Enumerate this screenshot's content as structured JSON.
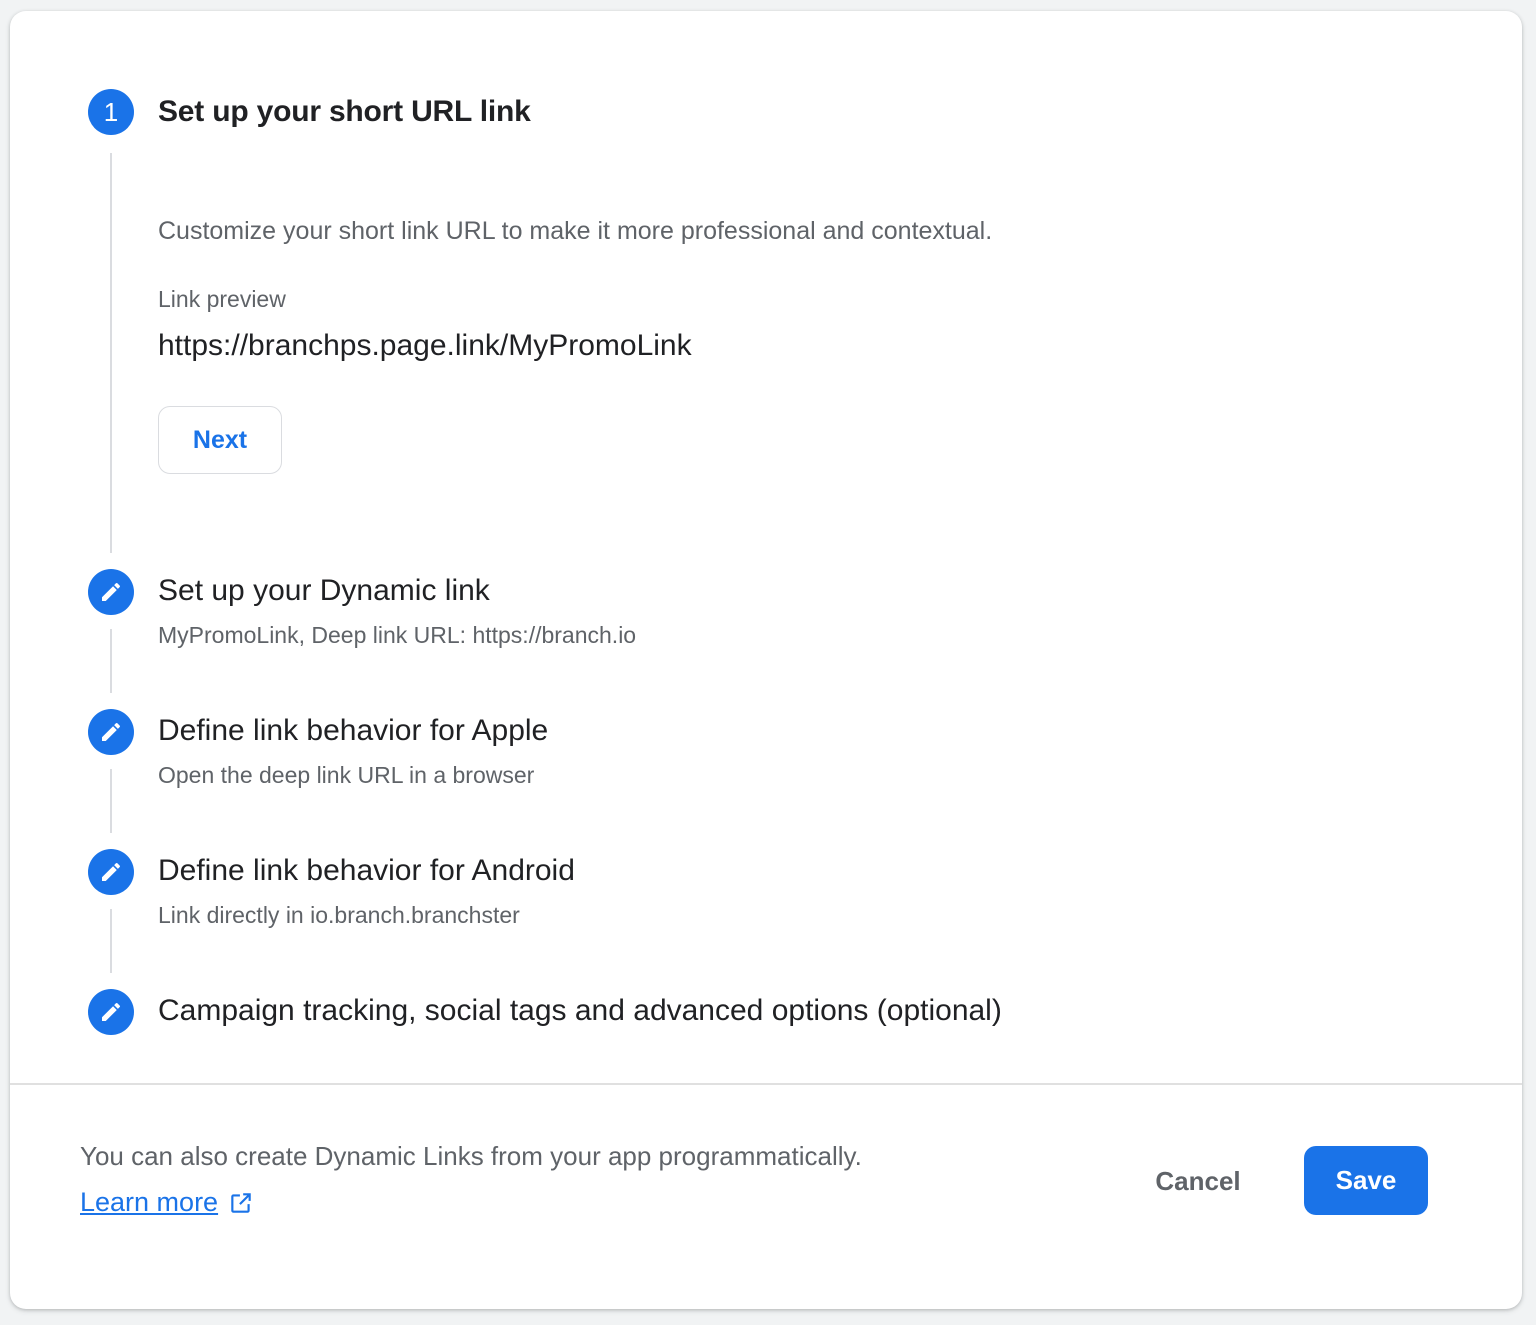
{
  "colors": {
    "accent": "#1a73e8",
    "text_primary": "#202124",
    "text_secondary": "#5f6368",
    "divider": "#dadce0"
  },
  "stepper": {
    "active_step": {
      "number": "1",
      "title": "Set up your short URL link",
      "description": "Customize your short link URL to make it more professional and contextual.",
      "preview_label": "Link preview",
      "preview_value": "https://branchps.page.link/MyPromoLink",
      "next_label": "Next"
    },
    "steps": [
      {
        "title": "Set up your Dynamic link",
        "subtitle": "MyPromoLink, Deep link URL: https://branch.io",
        "icon": "edit-icon"
      },
      {
        "title": "Define link behavior for Apple",
        "subtitle": "Open the deep link URL in a browser",
        "icon": "edit-icon"
      },
      {
        "title": "Define link behavior for Android",
        "subtitle": "Link directly in io.branch.branchster",
        "icon": "edit-icon"
      },
      {
        "title": "Campaign tracking, social tags and advanced options (optional)",
        "subtitle": "",
        "icon": "edit-icon"
      }
    ]
  },
  "footer": {
    "text": "You can also create Dynamic Links from your app programmatically.",
    "learn_more_label": "Learn more",
    "learn_more_icon": "open-in-new-icon",
    "cancel_label": "Cancel",
    "save_label": "Save"
  }
}
